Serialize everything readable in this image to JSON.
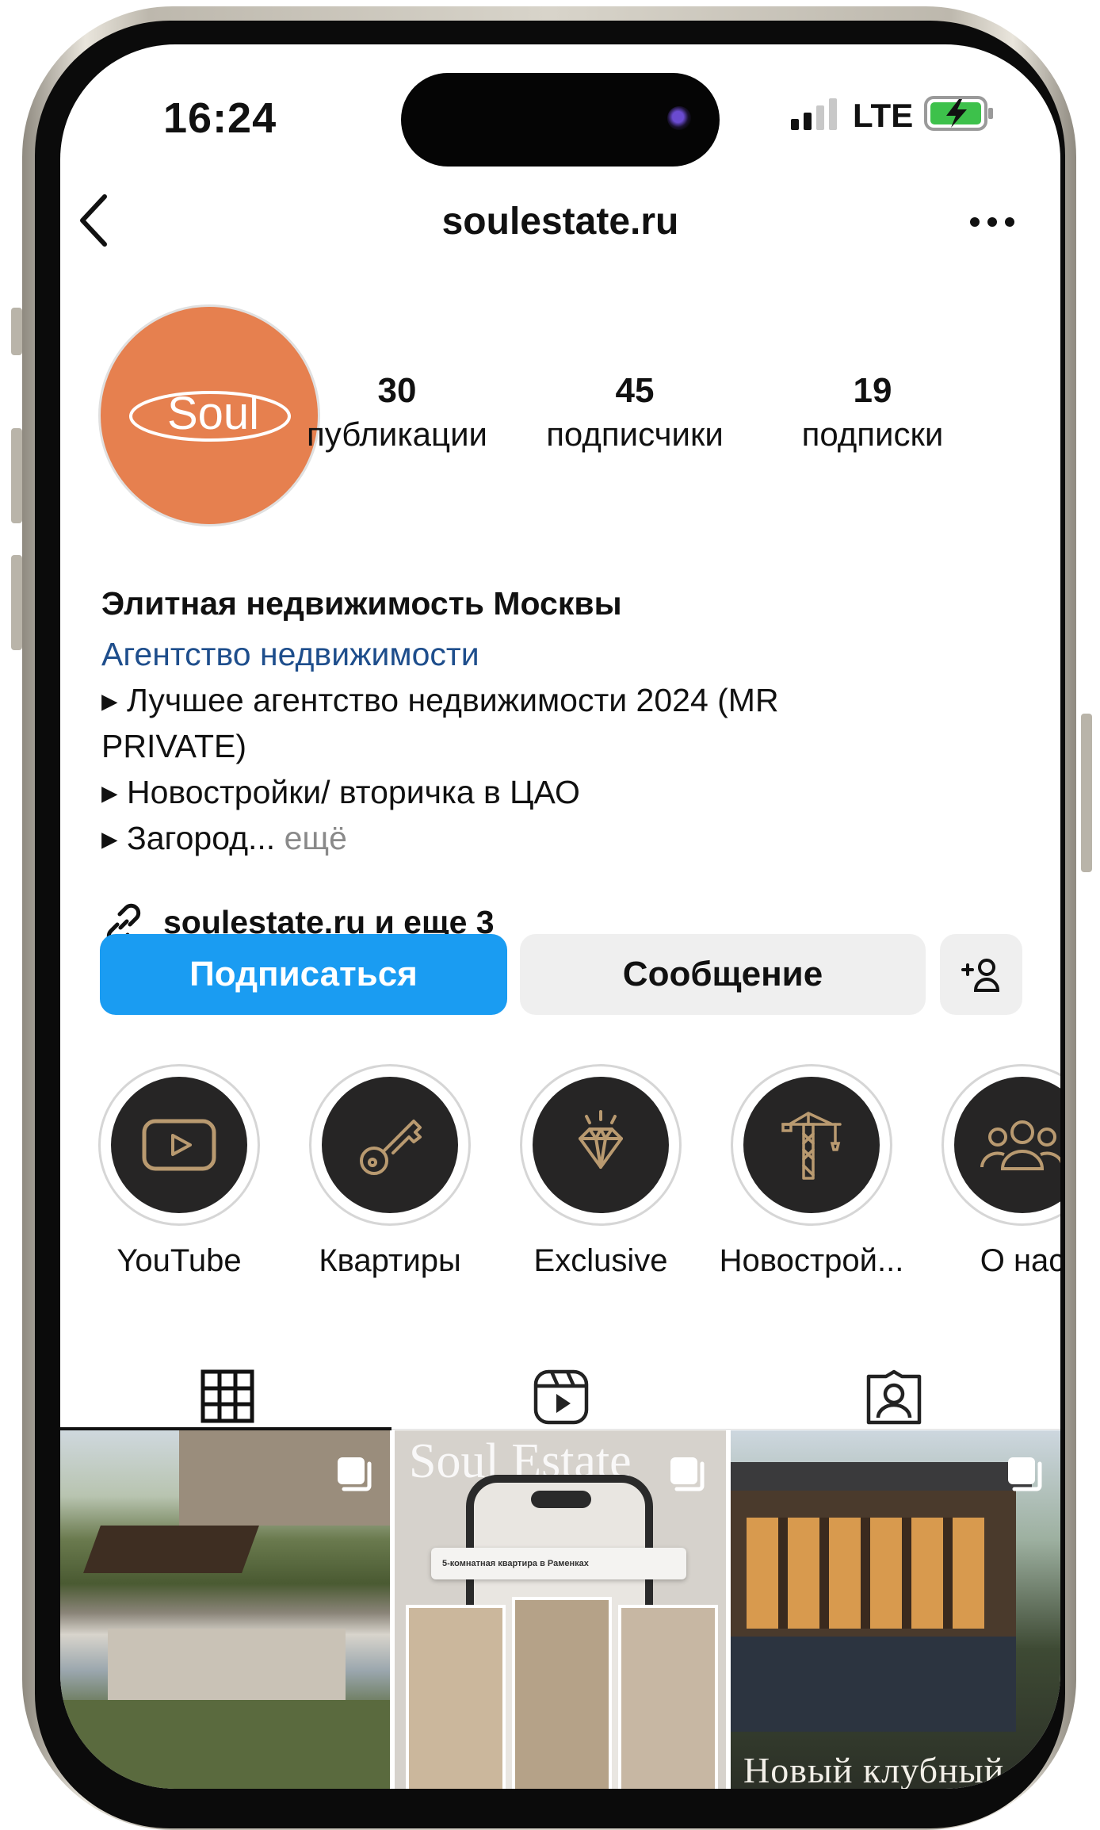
{
  "status_bar": {
    "time": "16:24",
    "network": "LTE"
  },
  "header": {
    "username": "soulestate.ru"
  },
  "profile": {
    "avatar_text": "Soul",
    "stats": [
      {
        "value": "30",
        "label": "публикации"
      },
      {
        "value": "45",
        "label": "подписчики"
      },
      {
        "value": "19",
        "label": "подписки"
      }
    ]
  },
  "bio": {
    "name": "Элитная недвижимость Москвы",
    "category": "Агентство недвижимости",
    "line1": "▸ Лучшее агентство недвижимости 2024 (MR",
    "line2": "PRIVATE)",
    "line3": "▸ Новостройки/ вторичка в ЦАО",
    "line4": "▸ Загород...",
    "more": " ещё",
    "link": "soulestate.ru и еще 3"
  },
  "actions": {
    "follow": "Подписаться",
    "message": "Сообщение",
    "follow_color": "#1a9cf2"
  },
  "highlights": [
    {
      "label": "YouTube",
      "icon": "youtube-icon"
    },
    {
      "label": "Квартиры",
      "icon": "key-icon"
    },
    {
      "label": "Exclusive",
      "icon": "diamond-icon"
    },
    {
      "label": "Новострой...",
      "icon": "crane-icon"
    },
    {
      "label": "О нас",
      "icon": "people-icon"
    }
  ],
  "posts": [
    {
      "caption": ""
    },
    {
      "caption": "Soul Estate",
      "search_text": "5-комнатная квартира в Раменках"
    },
    {
      "caption": "Новый клубный"
    }
  ],
  "colors": {
    "avatar_bg": "#e6804f",
    "highlight_icon": "#b99a70"
  }
}
